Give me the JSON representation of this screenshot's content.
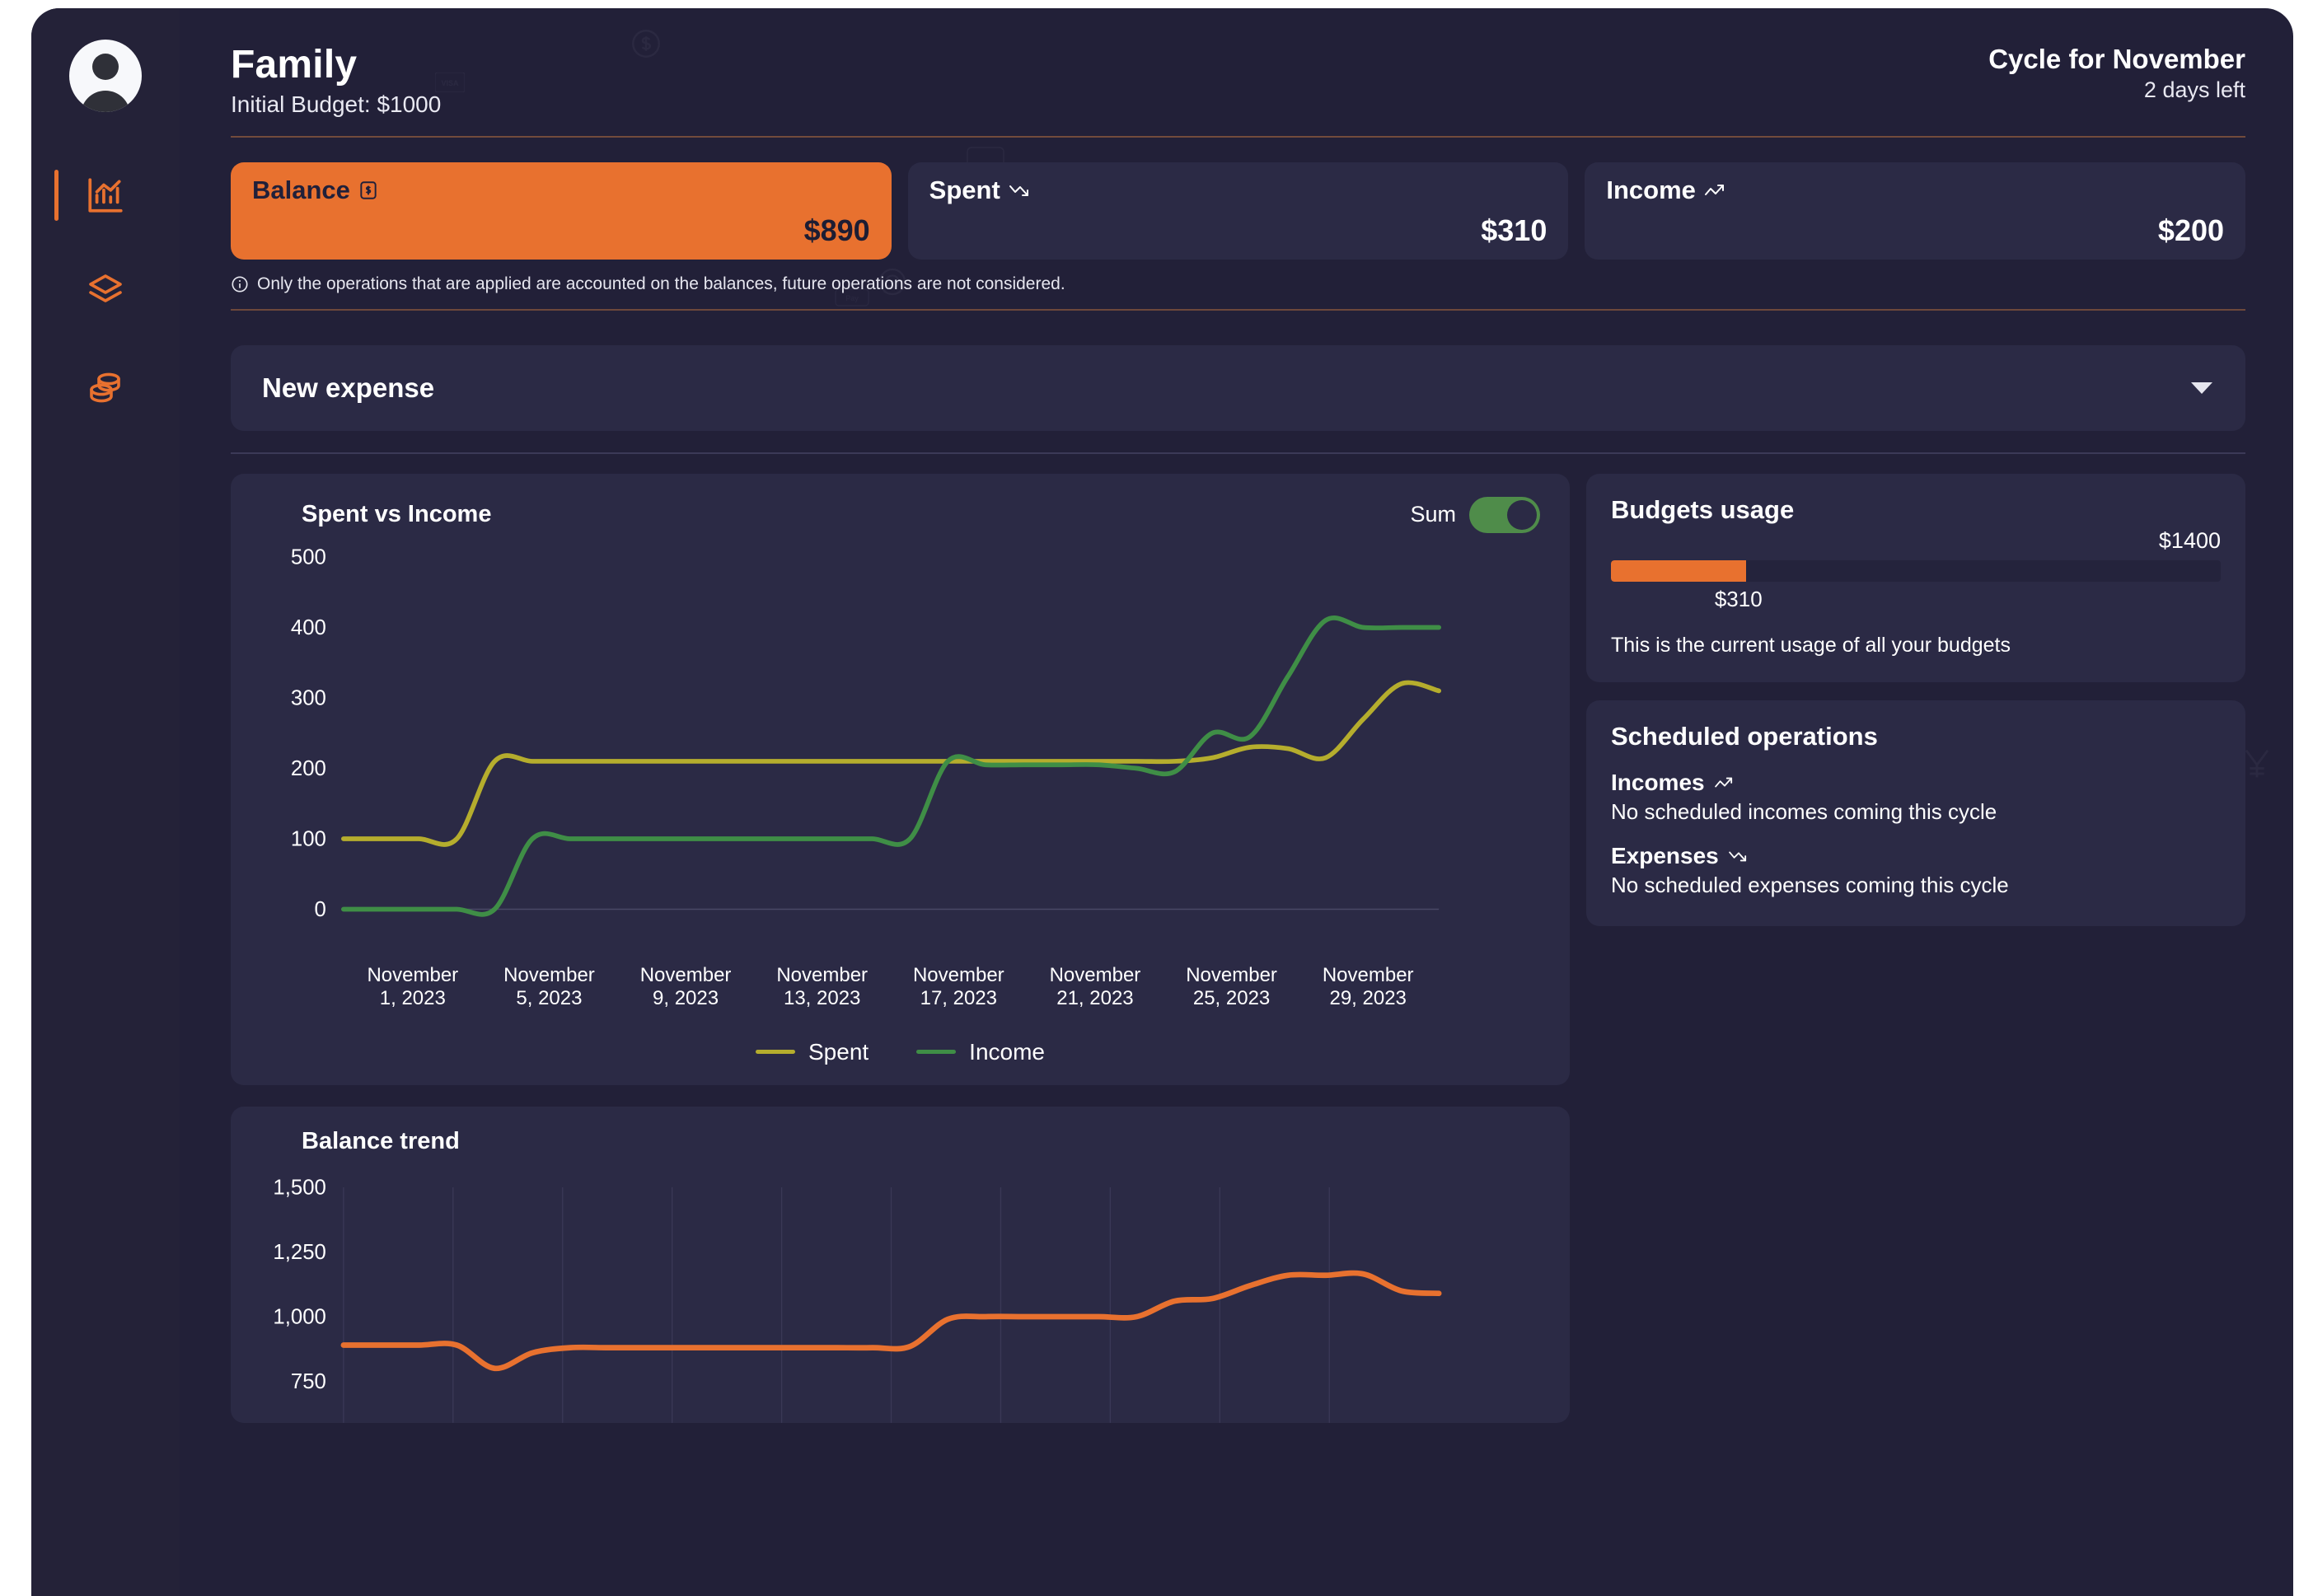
{
  "header": {
    "title": "Family",
    "subtitle": "Initial Budget: $1000",
    "cycle_title": "Cycle for November",
    "cycle_sub": "2 days left"
  },
  "sidebar": {
    "items": [
      {
        "name": "avatar",
        "icon": "user-avatar"
      },
      {
        "name": "analytics",
        "icon": "bar-chart-icon",
        "active": true
      },
      {
        "name": "layers",
        "icon": "layers-icon",
        "active": false
      },
      {
        "name": "coins",
        "icon": "coins-icon",
        "active": false
      }
    ]
  },
  "cards": [
    {
      "label": "Balance",
      "icon": "dollar-box-icon",
      "value": "$890",
      "accent": true,
      "accent_color": "#e8712f"
    },
    {
      "label": "Spent",
      "icon": "trend-down-icon",
      "value": "$310",
      "accent": false
    },
    {
      "label": "Income",
      "icon": "trend-up-icon",
      "value": "$200",
      "accent": false
    }
  ],
  "note": {
    "icon": "info-icon",
    "text": "Only the operations that are applied are accounted on the balances, future operations are not considered."
  },
  "expense_selector": {
    "label": "New expense",
    "icon": "chevron-down-icon"
  },
  "spent_vs_income": {
    "title": "Spent vs Income",
    "toggle_label": "Sum",
    "toggle_on": true
  },
  "budgets_usage": {
    "title": "Budgets usage",
    "total": "$1400",
    "used": "$310",
    "percent": 22.14,
    "description": "This is the current usage of all your budgets"
  },
  "scheduled_operations": {
    "title": "Scheduled operations",
    "groups": [
      {
        "label": "Incomes",
        "icon": "trend-up-icon",
        "body": "No scheduled incomes coming this cycle"
      },
      {
        "label": "Expenses",
        "icon": "trend-down-icon",
        "body": "No scheduled expenses coming this cycle"
      }
    ]
  },
  "balance_trend": {
    "title": "Balance trend"
  },
  "chart_data": [
    {
      "type": "line",
      "title": "Spent vs Income",
      "xlabel": "",
      "ylabel": "",
      "ylim": [
        0,
        500
      ],
      "yticks": [
        0,
        100,
        200,
        300,
        400,
        500
      ],
      "grid": false,
      "legend": "bottom-center",
      "x": [
        "November 1, 2023",
        "November 5, 2023",
        "November 9, 2023",
        "November 13, 2023",
        "November 17, 2023",
        "November 21, 2023",
        "November 25, 2023",
        "November 29, 2023"
      ],
      "xtick_lines": [
        "November\n1, 2023",
        "November\n5, 2023",
        "November\n9, 2023",
        "November\n13, 2023",
        "November\n17, 2023",
        "November\n21, 2023",
        "November\n25, 2023",
        "November\n29, 2023"
      ],
      "series": [
        {
          "name": "Spent",
          "color": "#b5ad2d",
          "days": [
            1,
            2,
            3,
            4,
            5,
            6,
            7,
            8,
            9,
            10,
            11,
            12,
            13,
            14,
            15,
            16,
            17,
            18,
            19,
            20,
            21,
            22,
            23,
            24,
            25,
            26,
            27,
            28,
            29,
            30
          ],
          "values": [
            100,
            100,
            100,
            100,
            210,
            210,
            210,
            210,
            210,
            210,
            210,
            210,
            210,
            210,
            210,
            210,
            210,
            210,
            210,
            210,
            210,
            210,
            210,
            215,
            230,
            228,
            215,
            270,
            320,
            310
          ]
        },
        {
          "name": "Income",
          "color": "#3f8e46",
          "days": [
            1,
            2,
            3,
            4,
            5,
            6,
            7,
            8,
            9,
            10,
            11,
            12,
            13,
            14,
            15,
            16,
            17,
            18,
            19,
            20,
            21,
            22,
            23,
            24,
            25,
            26,
            27,
            28,
            29,
            30
          ],
          "values": [
            0,
            0,
            0,
            0,
            0,
            100,
            100,
            100,
            100,
            100,
            100,
            100,
            100,
            100,
            100,
            100,
            210,
            205,
            205,
            205,
            205,
            200,
            195,
            250,
            245,
            330,
            410,
            400,
            400,
            400
          ]
        }
      ]
    },
    {
      "type": "line",
      "title": "Balance trend",
      "xlabel": "",
      "ylabel": "",
      "ylim": [
        650,
        1550
      ],
      "yticks": [
        750,
        1000,
        1250,
        1500
      ],
      "grid": true,
      "series": [
        {
          "name": "Balance",
          "color": "#e8712f",
          "days": [
            1,
            2,
            3,
            4,
            5,
            6,
            7,
            8,
            9,
            10,
            11,
            12,
            13,
            14,
            15,
            16,
            17,
            18,
            19,
            20,
            21,
            22,
            23,
            24,
            25,
            26,
            27,
            28,
            29,
            30
          ],
          "values": [
            890,
            890,
            890,
            890,
            800,
            860,
            880,
            880,
            880,
            880,
            880,
            880,
            880,
            880,
            880,
            885,
            990,
            1000,
            1000,
            1000,
            1000,
            1000,
            1060,
            1070,
            1120,
            1160,
            1160,
            1165,
            1100,
            1090
          ]
        }
      ]
    }
  ]
}
